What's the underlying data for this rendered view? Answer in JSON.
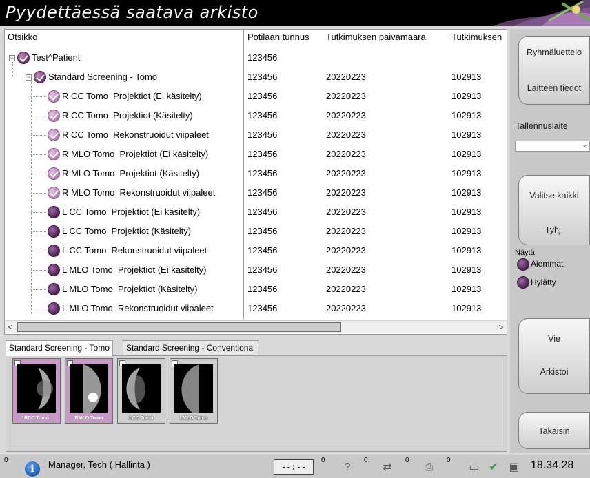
{
  "window": {
    "title": "Pyydettäessä saatava arkisto"
  },
  "table": {
    "columns": [
      "Otsikko",
      "Potilaan tunnus",
      "Tutkimuksen päivämäärä",
      "Tutkimuksen"
    ],
    "rows": [
      {
        "label": "Test^Patient",
        "status": "checked",
        "level": 0,
        "expander": "⊟",
        "patient_id": "123456",
        "date": "",
        "study": ""
      },
      {
        "label": "Standard Screening - Tomo",
        "status": "checked",
        "level": 1,
        "expander": "⊟",
        "patient_id": "123456",
        "date": "20220223",
        "study": "102913"
      },
      {
        "label": "R CC Tomo  Projektiot (Ei käsitelty)",
        "status": "light",
        "level": 2,
        "expander": "",
        "patient_id": "123456",
        "date": "20220223",
        "study": "102913"
      },
      {
        "label": "R CC Tomo  Projektiot (Käsitelty)",
        "status": "light",
        "level": 2,
        "expander": "",
        "patient_id": "123456",
        "date": "20220223",
        "study": "102913"
      },
      {
        "label": "R CC Tomo  Rekonstruoidut viipaleet",
        "status": "light",
        "level": 2,
        "expander": "",
        "patient_id": "123456",
        "date": "20220223",
        "study": "102913"
      },
      {
        "label": "R MLO Tomo  Projektiot (Ei käsitelty)",
        "status": "light",
        "level": 2,
        "expander": "",
        "patient_id": "123456",
        "date": "20220223",
        "study": "102913"
      },
      {
        "label": "R MLO Tomo  Projektiot (Käsitelty)",
        "status": "light",
        "level": 2,
        "expander": "",
        "patient_id": "123456",
        "date": "20220223",
        "study": "102913"
      },
      {
        "label": "R MLO Tomo  Rekonstruoidut viipaleet",
        "status": "light",
        "level": 2,
        "expander": "",
        "patient_id": "123456",
        "date": "20220223",
        "study": "102913"
      },
      {
        "label": "L CC Tomo  Projektiot (Ei käsitelty)",
        "status": "plain",
        "level": 2,
        "expander": "",
        "patient_id": "123456",
        "date": "20220223",
        "study": "102913"
      },
      {
        "label": "L CC Tomo  Projektiot (Käsitelty)",
        "status": "plain",
        "level": 2,
        "expander": "",
        "patient_id": "123456",
        "date": "20220223",
        "study": "102913"
      },
      {
        "label": "L CC Tomo  Rekonstruoidut viipaleet",
        "status": "plain",
        "level": 2,
        "expander": "",
        "patient_id": "123456",
        "date": "20220223",
        "study": "102913"
      },
      {
        "label": "L MLO Tomo  Projektiot (Ei käsitelty)",
        "status": "plain",
        "level": 2,
        "expander": "",
        "patient_id": "123456",
        "date": "20220223",
        "study": "102913"
      },
      {
        "label": "L MLO Tomo  Projektiot (Käsitelty)",
        "status": "plain",
        "level": 2,
        "expander": "",
        "patient_id": "123456",
        "date": "20220223",
        "study": "102913"
      },
      {
        "label": "L MLO Tomo  Rekonstruoidut viipaleet",
        "status": "plain",
        "level": 2,
        "expander": "",
        "patient_id": "123456",
        "date": "20220223",
        "study": "102913"
      }
    ],
    "scroll_left": "<",
    "scroll_right": ">"
  },
  "tabs": [
    {
      "label": "Standard Screening - Tomo",
      "active": true
    },
    {
      "label": "Standard Screening - Conventional",
      "active": false
    }
  ],
  "thumbnails": [
    {
      "label": "RCC Tomo",
      "selected": true
    },
    {
      "label": "RMLO Tomo",
      "selected": true
    },
    {
      "label": "LCC Tomo",
      "selected": false
    },
    {
      "label": "LMLO Tomo",
      "selected": false
    }
  ],
  "sidebar": {
    "group_list": "Ryhmäluettelo",
    "device_info": "Laitteen tiedot",
    "storage_device_label": "Tallennuslaite",
    "storage_device_value": "",
    "select_all": "Valitse kaikki",
    "clear": "Tyhj.",
    "show_label": "Näytä",
    "show_previous": "Aiemmat",
    "show_rejected": "Hylätty",
    "export": "Vie",
    "archive": "Arkistoi",
    "back": "Takaisin"
  },
  "statusbar": {
    "count_left": "0",
    "user": "Manager, Tech ( Hallinta )",
    "clock": "--:--",
    "counts": [
      "0",
      "0",
      "0",
      "0",
      "0"
    ],
    "time": "18.34.28"
  },
  "colors": {
    "accent_purple": "#6c2f69",
    "selected_thumb": "#c59ac4"
  }
}
